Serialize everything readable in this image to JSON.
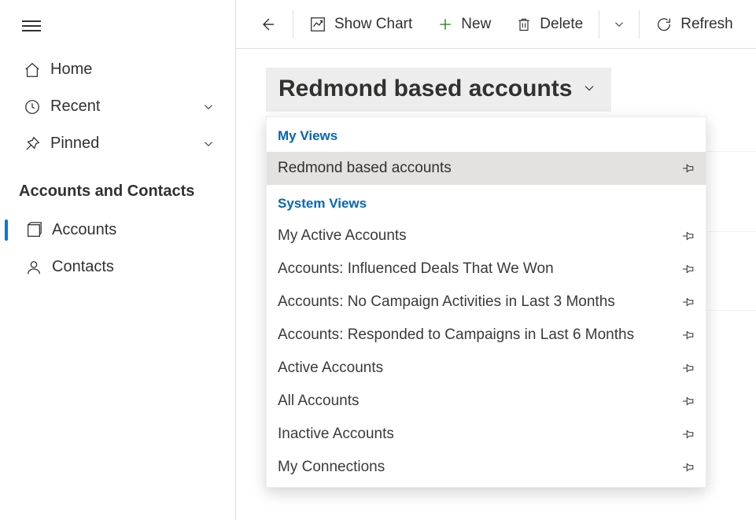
{
  "sidebar": {
    "nav": [
      {
        "label": "Home",
        "icon": "home"
      },
      {
        "label": "Recent",
        "icon": "clock",
        "chevron": true
      },
      {
        "label": "Pinned",
        "icon": "pin-angle",
        "chevron": true
      }
    ],
    "section_label": "Accounts and Contacts",
    "subnav": [
      {
        "label": "Accounts",
        "icon": "accounts",
        "selected": true
      },
      {
        "label": "Contacts",
        "icon": "person"
      }
    ]
  },
  "cmdbar": {
    "show_chart": "Show Chart",
    "new": "New",
    "delete": "Delete",
    "refresh": "Refresh"
  },
  "view_picker": {
    "current": "Redmond based accounts"
  },
  "dropdown": {
    "group1_label": "My Views",
    "group1_items": [
      {
        "label": "Redmond based accounts",
        "selected": true
      }
    ],
    "group2_label": "System Views",
    "group2_items": [
      {
        "label": "My Active Accounts"
      },
      {
        "label": "Accounts: Influenced Deals That We Won"
      },
      {
        "label": "Accounts: No Campaign Activities in Last 3 Months"
      },
      {
        "label": "Accounts: Responded to Campaigns in Last 6 Months"
      },
      {
        "label": "Active Accounts"
      },
      {
        "label": "All Accounts"
      },
      {
        "label": "Inactive Accounts"
      },
      {
        "label": "My Connections"
      }
    ]
  }
}
